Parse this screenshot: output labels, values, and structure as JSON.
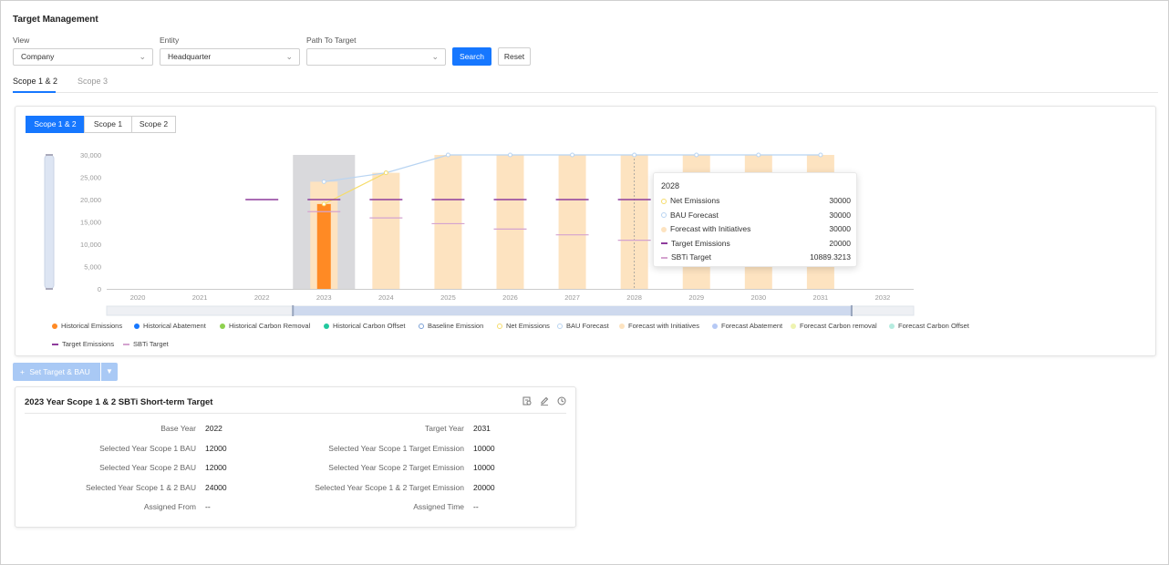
{
  "page_title": "Target Management",
  "filters": {
    "view_label": "View",
    "view_value": "Company",
    "entity_label": "Entity",
    "entity_value": "Headquarter",
    "path_label": "Path To Target",
    "path_value": "",
    "search_label": "Search",
    "reset_label": "Reset"
  },
  "main_tabs": [
    {
      "label": "Scope 1 & 2",
      "active": true
    },
    {
      "label": "Scope 3",
      "active": false
    }
  ],
  "chart_tabs": [
    {
      "label": "Scope 1 & 2",
      "active": true
    },
    {
      "label": "Scope 1",
      "active": false
    },
    {
      "label": "Scope 2",
      "active": false
    }
  ],
  "chart_data": {
    "type": "bar",
    "categories": [
      "2020",
      "2021",
      "2022",
      "2023",
      "2024",
      "2025",
      "2026",
      "2027",
      "2028",
      "2029",
      "2030",
      "2031",
      "2032"
    ],
    "ylim": [
      0,
      30000
    ],
    "yticks": [
      0,
      5000,
      10000,
      15000,
      20000,
      25000,
      30000
    ],
    "ytick_labels": [
      "0",
      "5,000",
      "10,000",
      "15,000",
      "20,000",
      "25,000",
      "30,000"
    ],
    "highlight_category": "2023",
    "series": [
      {
        "name": "Historical Emissions",
        "type": "bar",
        "color": "#ff8a24",
        "values": [
          null,
          null,
          null,
          19000,
          null,
          null,
          null,
          null,
          null,
          null,
          null,
          null,
          null
        ]
      },
      {
        "name": "Forecast with Initiatives",
        "type": "bar",
        "color": "#fde3c0",
        "values": [
          null,
          null,
          null,
          24000,
          26000,
          30000,
          30000,
          30000,
          30000,
          30000,
          30000,
          30000,
          null
        ]
      },
      {
        "name": "BAU Forecast",
        "type": "line",
        "color": "#b8d4f2",
        "values": [
          null,
          null,
          null,
          24000,
          26000,
          30000,
          30000,
          30000,
          30000,
          30000,
          30000,
          30000,
          null
        ]
      },
      {
        "name": "Net Emissions",
        "type": "line",
        "color": "#f6dc6a",
        "values": [
          null,
          null,
          null,
          19000,
          26000,
          null,
          null,
          null,
          null,
          null,
          null,
          null,
          null
        ]
      },
      {
        "name": "Target Emissions",
        "type": "marker",
        "color": "#8e3c9c",
        "values": [
          null,
          null,
          20000,
          20000,
          20000,
          20000,
          20000,
          20000,
          20000,
          null,
          null,
          null,
          null
        ]
      },
      {
        "name": "SBTi Target",
        "type": "marker",
        "color": "#d4a3cf",
        "values": [
          null,
          null,
          null,
          17300,
          15900,
          14600,
          13400,
          12100,
          10889.3213,
          null,
          null,
          null,
          null
        ]
      }
    ],
    "legend": [
      {
        "name": "Historical Emissions",
        "color": "#ff8a24",
        "shape": "dot"
      },
      {
        "name": "Historical Abatement",
        "color": "#1677ff",
        "shape": "dot"
      },
      {
        "name": "Historical Carbon Removal",
        "color": "#8fd14f",
        "shape": "dot"
      },
      {
        "name": "Historical Carbon Offset",
        "color": "#22c89e",
        "shape": "dot"
      },
      {
        "name": "Baseline Emission",
        "color": "#7aa0d6",
        "shape": "line-dot"
      },
      {
        "name": "Net Emissions",
        "color": "#f6dc6a",
        "shape": "line-dot"
      },
      {
        "name": "BAU Forecast",
        "color": "#b8d4f2",
        "shape": "line-dot"
      },
      {
        "name": "Forecast with Initiatives",
        "color": "#fde3c0",
        "shape": "dot"
      },
      {
        "name": "Forecast Abatement",
        "color": "#b6c9f5",
        "shape": "dot"
      },
      {
        "name": "Forecast Carbon removal",
        "color": "#eef3b0",
        "shape": "dot"
      },
      {
        "name": "Forecast Carbon Offset",
        "color": "#b6ece0",
        "shape": "dot"
      },
      {
        "name": "Target Emissions",
        "color": "#8e3c9c",
        "shape": "dash"
      },
      {
        "name": "SBTi Target",
        "color": "#d4a3cf",
        "shape": "dash"
      }
    ]
  },
  "tooltip": {
    "title": "2028",
    "rows": [
      {
        "name": "Net Emissions",
        "value": "30000",
        "color": "#f6dc6a",
        "shape": "line-dot"
      },
      {
        "name": "BAU Forecast",
        "value": "30000",
        "color": "#b8d4f2",
        "shape": "line-dot"
      },
      {
        "name": "Forecast with Initiatives",
        "value": "30000",
        "color": "#fde3c0",
        "shape": "dot"
      },
      {
        "name": "Target Emissions",
        "value": "20000",
        "color": "#8e3c9c",
        "shape": "dash"
      },
      {
        "name": "SBTi Target",
        "value": "10889.3213",
        "color": "#d4a3cf",
        "shape": "dash"
      }
    ]
  },
  "actions": {
    "set_target_label": "Set Target & BAU"
  },
  "target_card": {
    "title": "2023 Year Scope 1 & 2 SBTi Short-term Target",
    "icons": [
      "report-icon",
      "edit-icon",
      "history-icon"
    ],
    "left": [
      {
        "label": "Base Year",
        "value": "2022"
      },
      {
        "label": "Selected Year Scope 1 BAU",
        "value": "12000"
      },
      {
        "label": "Selected Year Scope 2 BAU",
        "value": "12000"
      },
      {
        "label": "Selected Year Scope 1 & 2 BAU",
        "value": "24000"
      },
      {
        "label": "Assigned From",
        "value": "--"
      }
    ],
    "right": [
      {
        "label": "Target Year",
        "value": "2031"
      },
      {
        "label": "Selected Year Scope 1 Target Emission",
        "value": "10000"
      },
      {
        "label": "Selected Year Scope 2 Target Emission",
        "value": "10000"
      },
      {
        "label": "Selected Year Scope 1 & 2 Target Emission",
        "value": "20000"
      },
      {
        "label": "Assigned Time",
        "value": "--"
      }
    ]
  }
}
